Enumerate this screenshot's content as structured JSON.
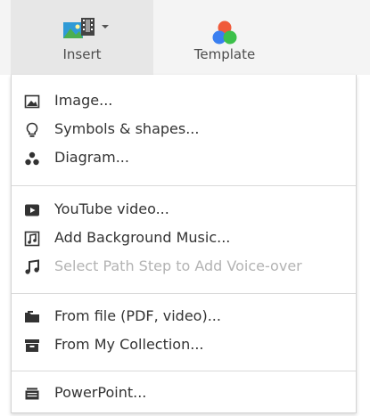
{
  "toolbar": {
    "insert_label": "Insert",
    "template_label": "Template"
  },
  "menu": {
    "groups": [
      {
        "items": [
          {
            "label": "Image...",
            "icon": "image-icon",
            "enabled": true
          },
          {
            "label": "Symbols & shapes...",
            "icon": "lightbulb-icon",
            "enabled": true
          },
          {
            "label": "Diagram...",
            "icon": "diagram-icon",
            "enabled": true
          }
        ]
      },
      {
        "items": [
          {
            "label": "YouTube video...",
            "icon": "youtube-play-icon",
            "enabled": true
          },
          {
            "label": "Add Background Music...",
            "icon": "music-file-icon",
            "enabled": true
          },
          {
            "label": "Select Path Step to Add Voice-over",
            "icon": "music-note-icon",
            "enabled": false
          }
        ]
      },
      {
        "items": [
          {
            "label": "From file (PDF, video)...",
            "icon": "folder-icon",
            "enabled": true
          },
          {
            "label": "From My Collection...",
            "icon": "archive-box-icon",
            "enabled": true
          }
        ]
      },
      {
        "items": [
          {
            "label": "PowerPoint...",
            "icon": "slides-icon",
            "enabled": true
          }
        ]
      }
    ]
  },
  "colors": {
    "toolbar_bg": "#f4f4f4",
    "insert_active_bg": "#e7e7e7",
    "text": "#333333",
    "disabled_text": "#b3b3b3"
  }
}
